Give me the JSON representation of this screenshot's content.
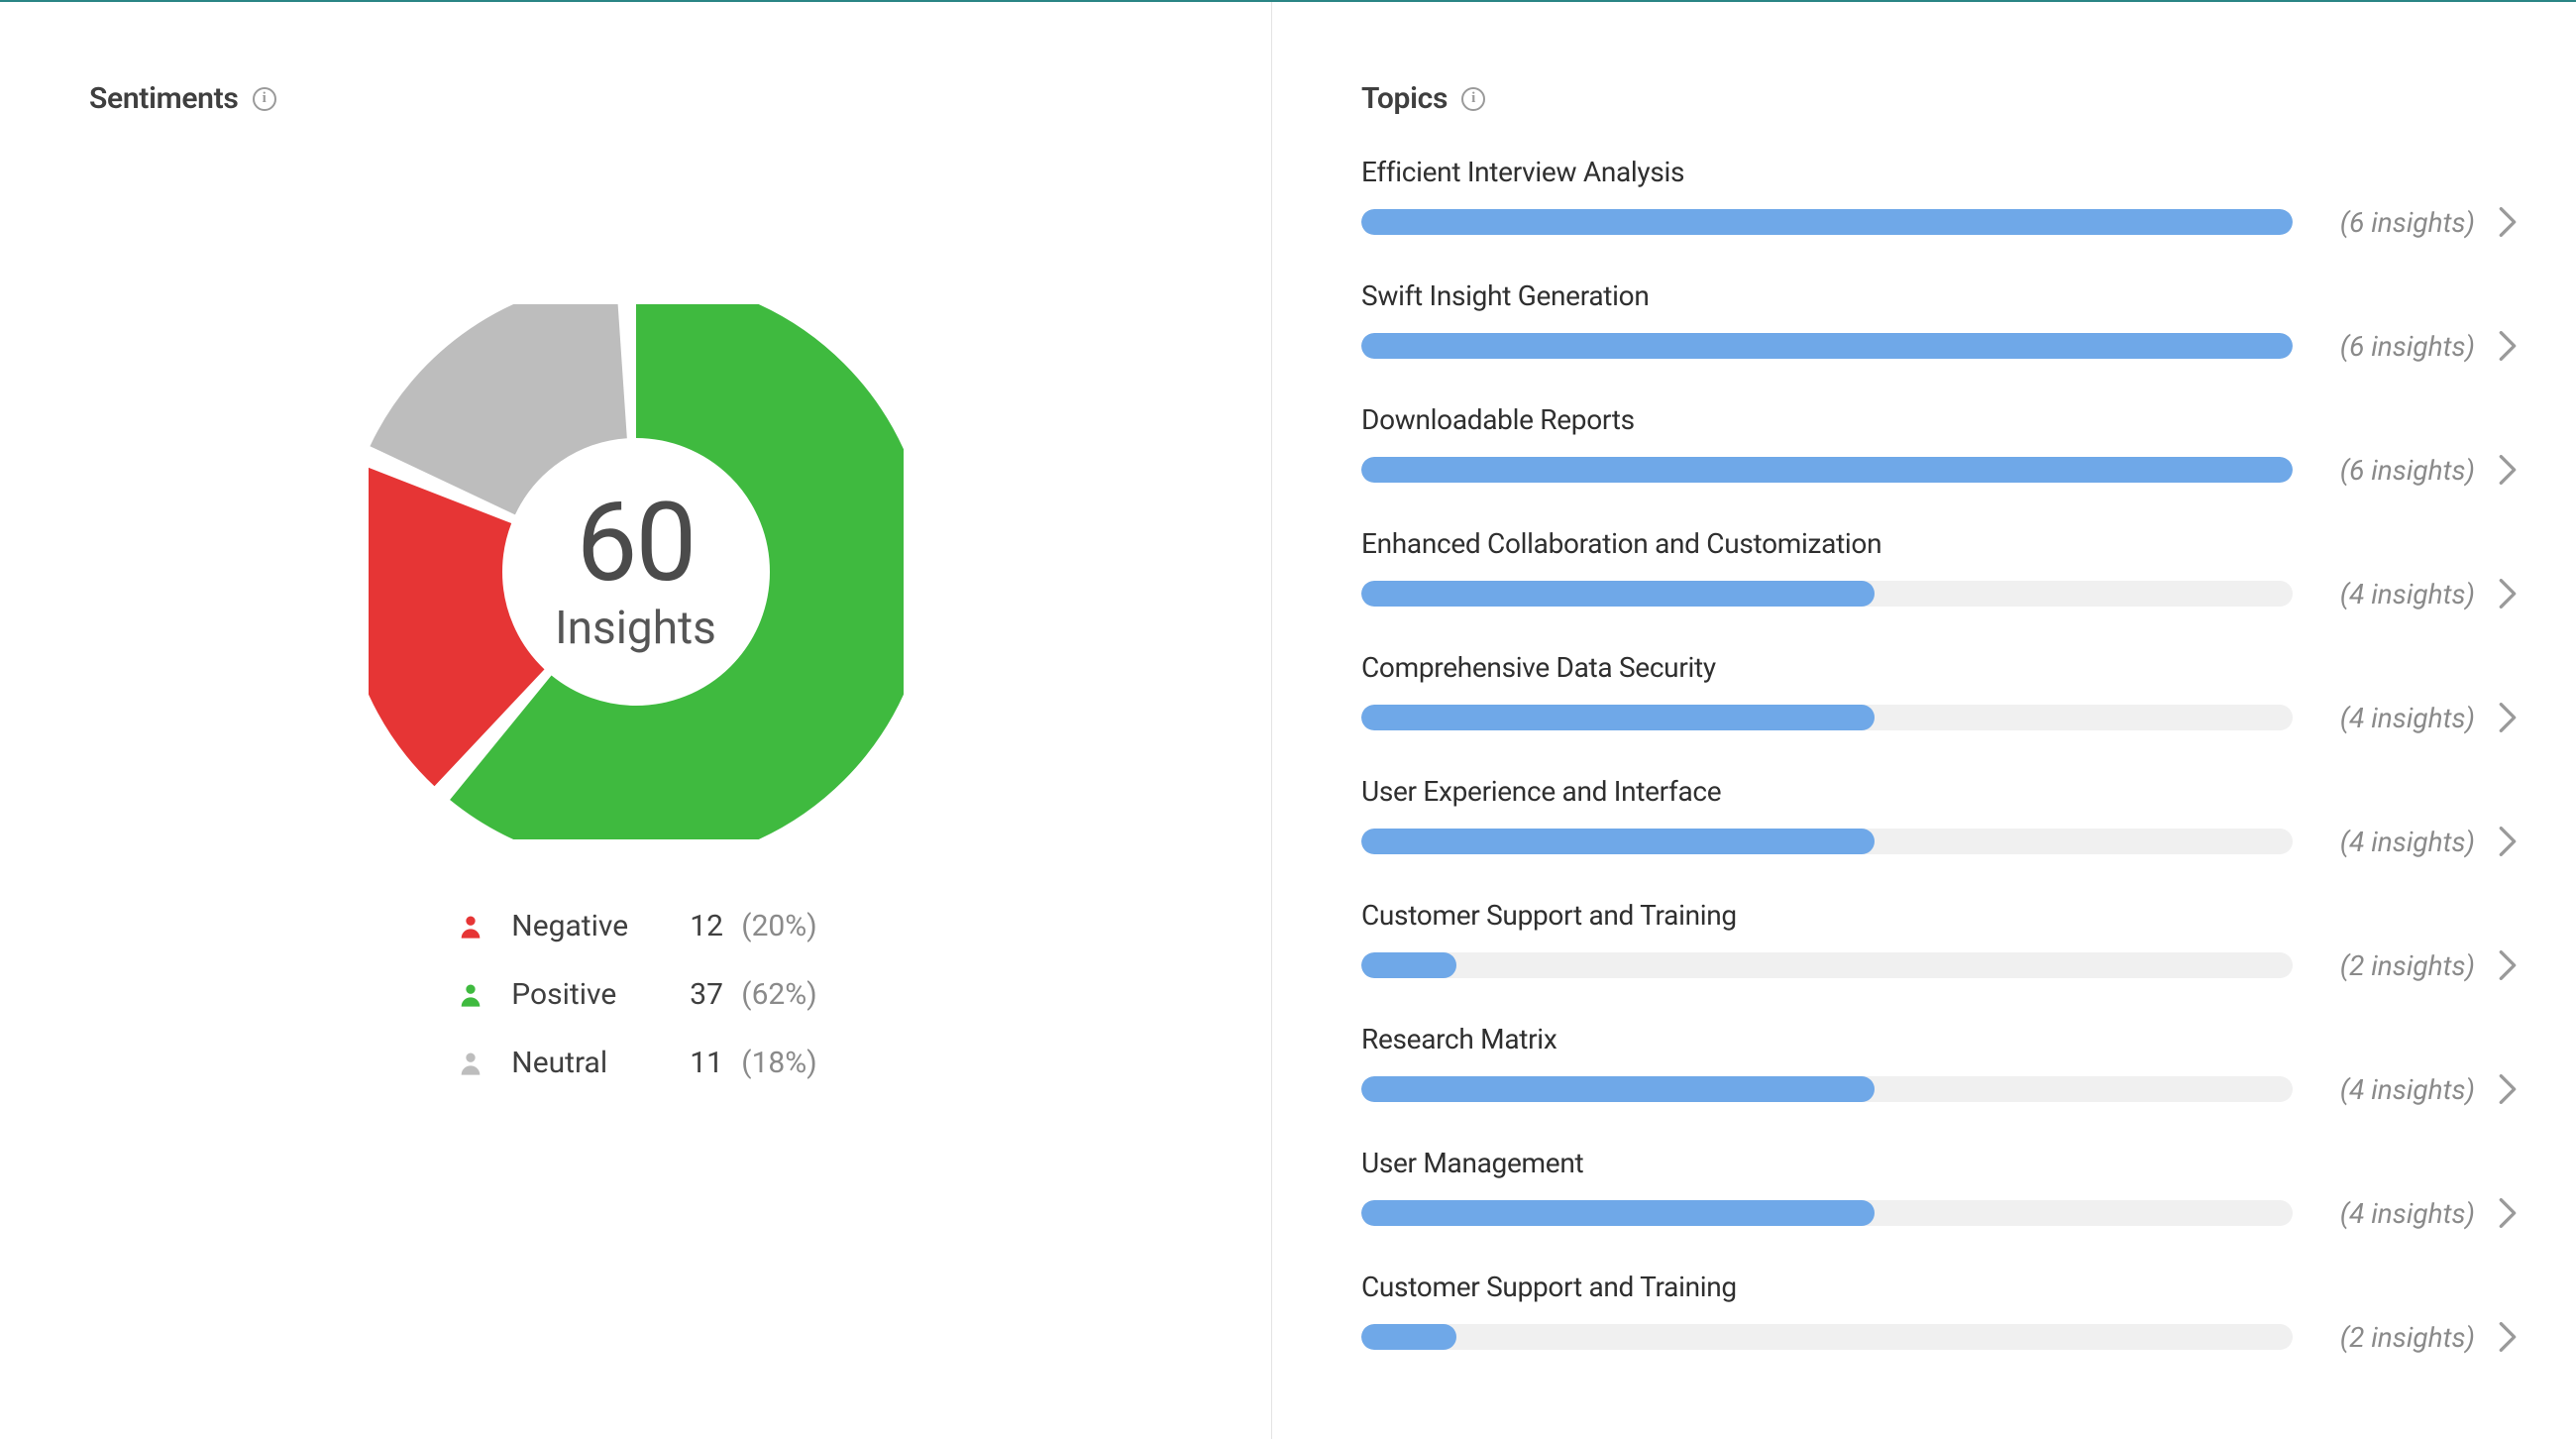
{
  "sentiments": {
    "title": "Sentiments",
    "total": "60",
    "total_label": "Insights",
    "colors": {
      "positive": "#3fba3f",
      "negative": "#e63535",
      "neutral": "#bdbdbd"
    },
    "items": [
      {
        "key": "negative",
        "label": "Negative",
        "count": "12",
        "pct": "(20%)"
      },
      {
        "key": "positive",
        "label": "Positive",
        "count": "37",
        "pct": "(62%)"
      },
      {
        "key": "neutral",
        "label": "Neutral",
        "count": "11",
        "pct": "(18%)"
      }
    ]
  },
  "topics": {
    "title": "Topics",
    "max": 6,
    "bar_color": "#6fa8e8",
    "items": [
      {
        "label": "Efficient Interview Analysis",
        "insights": 6,
        "meta": "(6 insights)"
      },
      {
        "label": "Swift Insight Generation",
        "insights": 6,
        "meta": "(6 insights)"
      },
      {
        "label": "Downloadable Reports",
        "insights": 6,
        "meta": "(6 insights)"
      },
      {
        "label": "Enhanced Collaboration and Customization",
        "insights": 4,
        "meta": "(4 insights)"
      },
      {
        "label": "Comprehensive Data Security",
        "insights": 4,
        "meta": "(4 insights)"
      },
      {
        "label": "User Experience and Interface",
        "insights": 4,
        "meta": "(4 insights)"
      },
      {
        "label": "Customer Support and Training",
        "insights": 2,
        "meta": "(2 insights)"
      },
      {
        "label": "Research Matrix",
        "insights": 4,
        "meta": "(4 insights)"
      },
      {
        "label": "User Management",
        "insights": 4,
        "meta": "(4 insights)"
      },
      {
        "label": "Customer Support and Training",
        "insights": 2,
        "meta": "(2 insights)"
      }
    ]
  },
  "chart_data": [
    {
      "type": "pie",
      "title": "Sentiments",
      "categories": [
        "Negative",
        "Positive",
        "Neutral"
      ],
      "values": [
        12,
        37,
        11
      ],
      "percentages": [
        20,
        62,
        18
      ],
      "total": 60,
      "total_label": "Insights",
      "colors": [
        "#e63535",
        "#3fba3f",
        "#bdbdbd"
      ]
    },
    {
      "type": "bar",
      "title": "Topics",
      "categories": [
        "Efficient Interview Analysis",
        "Swift Insight Generation",
        "Downloadable Reports",
        "Enhanced Collaboration and Customization",
        "Comprehensive Data Security",
        "User Experience and Interface",
        "Customer Support and Training",
        "Research Matrix",
        "User Management",
        "Customer Support and Training"
      ],
      "values": [
        6,
        6,
        6,
        4,
        4,
        4,
        2,
        4,
        4,
        2
      ],
      "xlabel": "",
      "ylabel": "insights",
      "ylim": [
        0,
        6
      ]
    }
  ]
}
